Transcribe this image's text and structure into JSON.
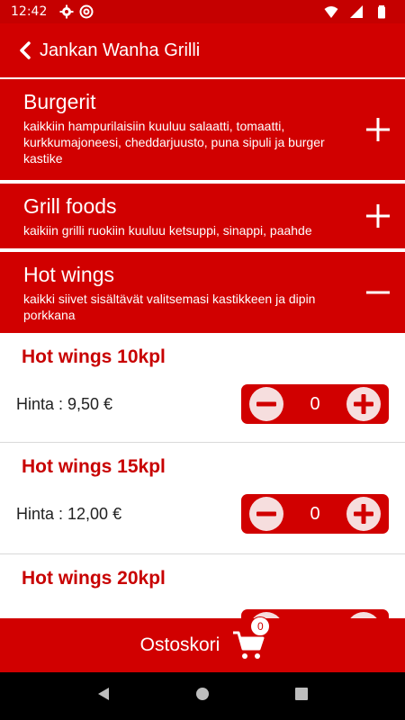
{
  "status_bar": {
    "time": "12:42",
    "icons": [
      "gear-icon",
      "at-icon",
      "wifi-icon",
      "signal-icon",
      "battery-icon"
    ]
  },
  "app_bar": {
    "title": "Jankan Wanha Grilli",
    "back_icon": "chevron-left-icon"
  },
  "categories": [
    {
      "title": "Burgerit",
      "description": "kaikkiin hampurilaisiin kuuluu salaatti, tomaatti, kurkkumajoneesi, cheddarjuusto, puna sipuli ja burger kastike",
      "toggle_icon": "plus-icon"
    },
    {
      "title": "Grill foods",
      "description": "kaikiin grilli ruokiin kuuluu ketsuppi, sinappi, paahde",
      "toggle_icon": "plus-icon"
    },
    {
      "title": "Hot wings",
      "description": "kaikki siivet sisältävät valitsemasi kastikkeen ja dipin porkkana",
      "toggle_icon": "minus-icon"
    }
  ],
  "items": [
    {
      "title": "Hot wings 10kpl",
      "price": "Hinta : 9,50 €",
      "quantity": "0"
    },
    {
      "title": "Hot wings 15kpl",
      "price": "Hinta : 12,00 €",
      "quantity": "0"
    },
    {
      "title": "Hot wings 20kpl",
      "price": "",
      "quantity": ""
    }
  ],
  "cart": {
    "label": "Ostoskori",
    "count": "0"
  },
  "colors": {
    "primary": "#d10000",
    "status": "#c50000",
    "item_title": "#c80000",
    "button_bg": "#f6dede"
  }
}
